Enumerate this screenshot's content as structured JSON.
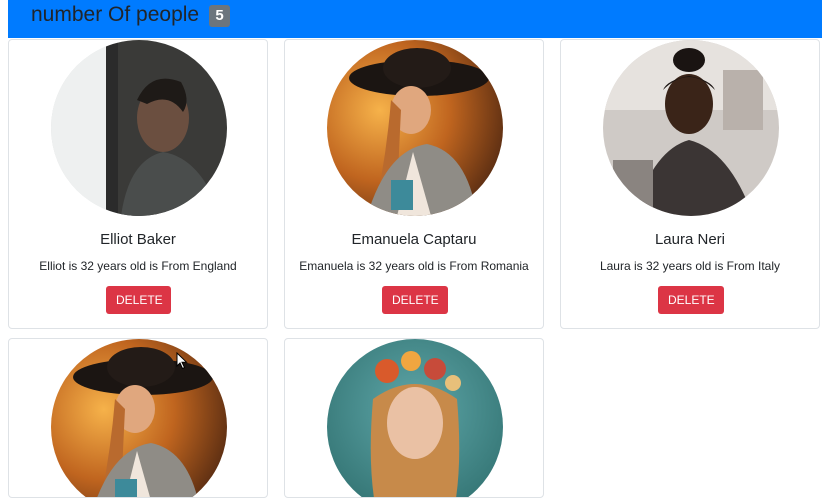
{
  "header": {
    "title": "number Of people",
    "count": "5"
  },
  "people": [
    {
      "name": "Elliot Baker",
      "description": "Elliot is 32 years old is From England",
      "delete_label": "DELETE",
      "photo": "man-by-window-photo"
    },
    {
      "name": "Emanuela Captaru",
      "description": "Emanuela is 32 years old is From Romania",
      "delete_label": "DELETE",
      "photo": "woman-in-hat-photo"
    },
    {
      "name": "Laura Neri",
      "description": "Laura is 32 years old is From Italy",
      "delete_label": "DELETE",
      "photo": "woman-with-bun-photo"
    },
    {
      "photo": "woman-in-hat-photo"
    },
    {
      "photo": "woman-with-flowers-photo"
    }
  ],
  "colors": {
    "header_bg": "#007bff",
    "badge_bg": "#6c757d",
    "delete_bg": "#dc3545",
    "card_border": "#dee2e6"
  }
}
